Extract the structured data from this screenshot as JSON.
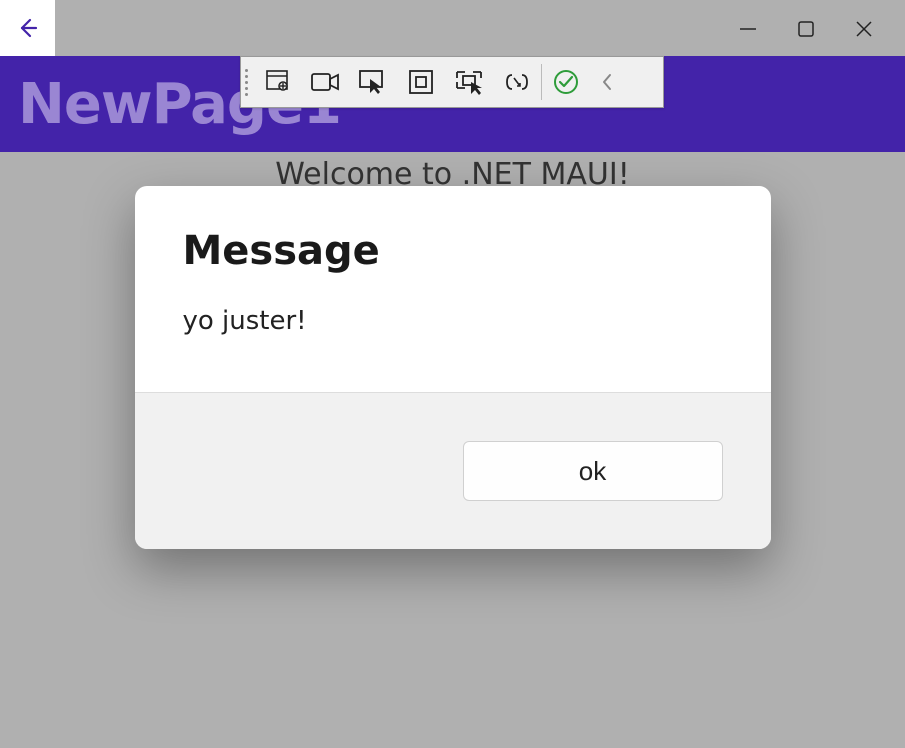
{
  "window": {
    "back_icon": "←"
  },
  "header": {
    "title": "NewPage1"
  },
  "content": {
    "welcome": "Welcome to .NET MAUI!"
  },
  "dialog": {
    "title": "Message",
    "text": "yo juster!",
    "ok_label": "ok"
  },
  "dev_toolbar": {
    "items": [
      {
        "name": "visual-tree-icon"
      },
      {
        "name": "video-icon"
      },
      {
        "name": "cursor-select-icon"
      },
      {
        "name": "layout-box-icon"
      },
      {
        "name": "hot-reload-layout-icon"
      },
      {
        "name": "xaml-binding-icon"
      },
      {
        "name": "checkmark-icon"
      },
      {
        "name": "chevron-left-icon"
      }
    ]
  },
  "colors": {
    "accent": "#4323a9",
    "accent_light": "#9a86d3",
    "dialog_action_bg": "#f1f1f1"
  }
}
